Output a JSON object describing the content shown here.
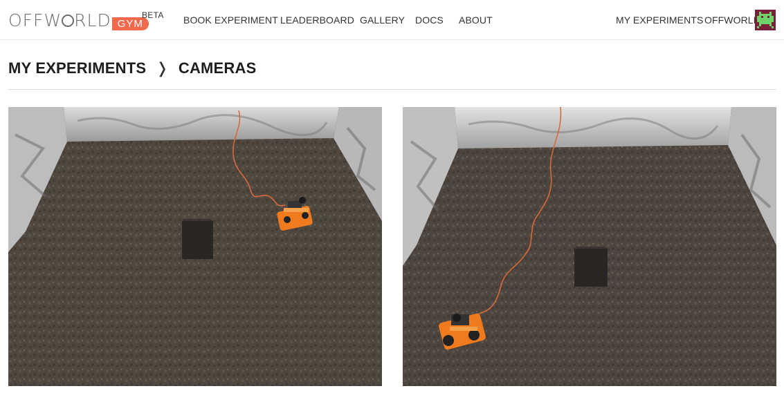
{
  "brand": {
    "logo_part1": "OFFW",
    "logo_part2": "RLD",
    "logo_gym": "GYM",
    "beta_label": "BETA"
  },
  "nav": {
    "left": [
      "BOOK EXPERIMENT",
      "LEADERBOARD",
      "GALLERY",
      "DOCS",
      "ABOUT"
    ],
    "right": [
      "MY EXPERIMENTS",
      "OFFWORLD"
    ]
  },
  "page": {
    "crumb_parent": "MY EXPERIMENTS",
    "crumb_separator": "❭",
    "crumb_current": "CAMERAS"
  },
  "colors": {
    "accent": "#f26a4b",
    "avatar_bg": "#7a1f3a",
    "avatar_fg": "#6fd36a",
    "gravel": "#4e4640",
    "robot": "#f07a1e"
  },
  "cameras": [
    {
      "icon": "camera-feed-1"
    },
    {
      "icon": "camera-feed-2"
    }
  ]
}
